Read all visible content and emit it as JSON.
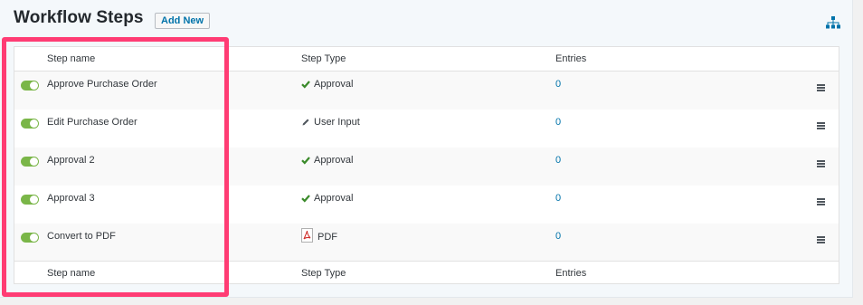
{
  "header": {
    "title": "Workflow Steps",
    "add_new_label": "Add New",
    "sitemap_icon": "sitemap-icon"
  },
  "table": {
    "columns": {
      "name": "Step name",
      "type": "Step Type",
      "entries": "Entries"
    },
    "rows": [
      {
        "name": "Approve Purchase Order",
        "type": "Approval",
        "type_icon": "check-icon",
        "entries": "0",
        "active": true
      },
      {
        "name": "Edit Purchase Order",
        "type": "User Input",
        "type_icon": "pencil-icon",
        "entries": "0",
        "active": true
      },
      {
        "name": "Approval 2",
        "type": "Approval",
        "type_icon": "check-icon",
        "entries": "0",
        "active": true
      },
      {
        "name": "Approval 3",
        "type": "Approval",
        "type_icon": "check-icon",
        "entries": "0",
        "active": true
      },
      {
        "name": "Convert to PDF",
        "type": "PDF",
        "type_icon": "pdf-icon",
        "entries": "0",
        "active": true
      }
    ]
  },
  "colors": {
    "toggle_on": "#7ab648",
    "highlight": "#ff3c74",
    "link": "#0073aa",
    "check": "#3a8a2a"
  }
}
